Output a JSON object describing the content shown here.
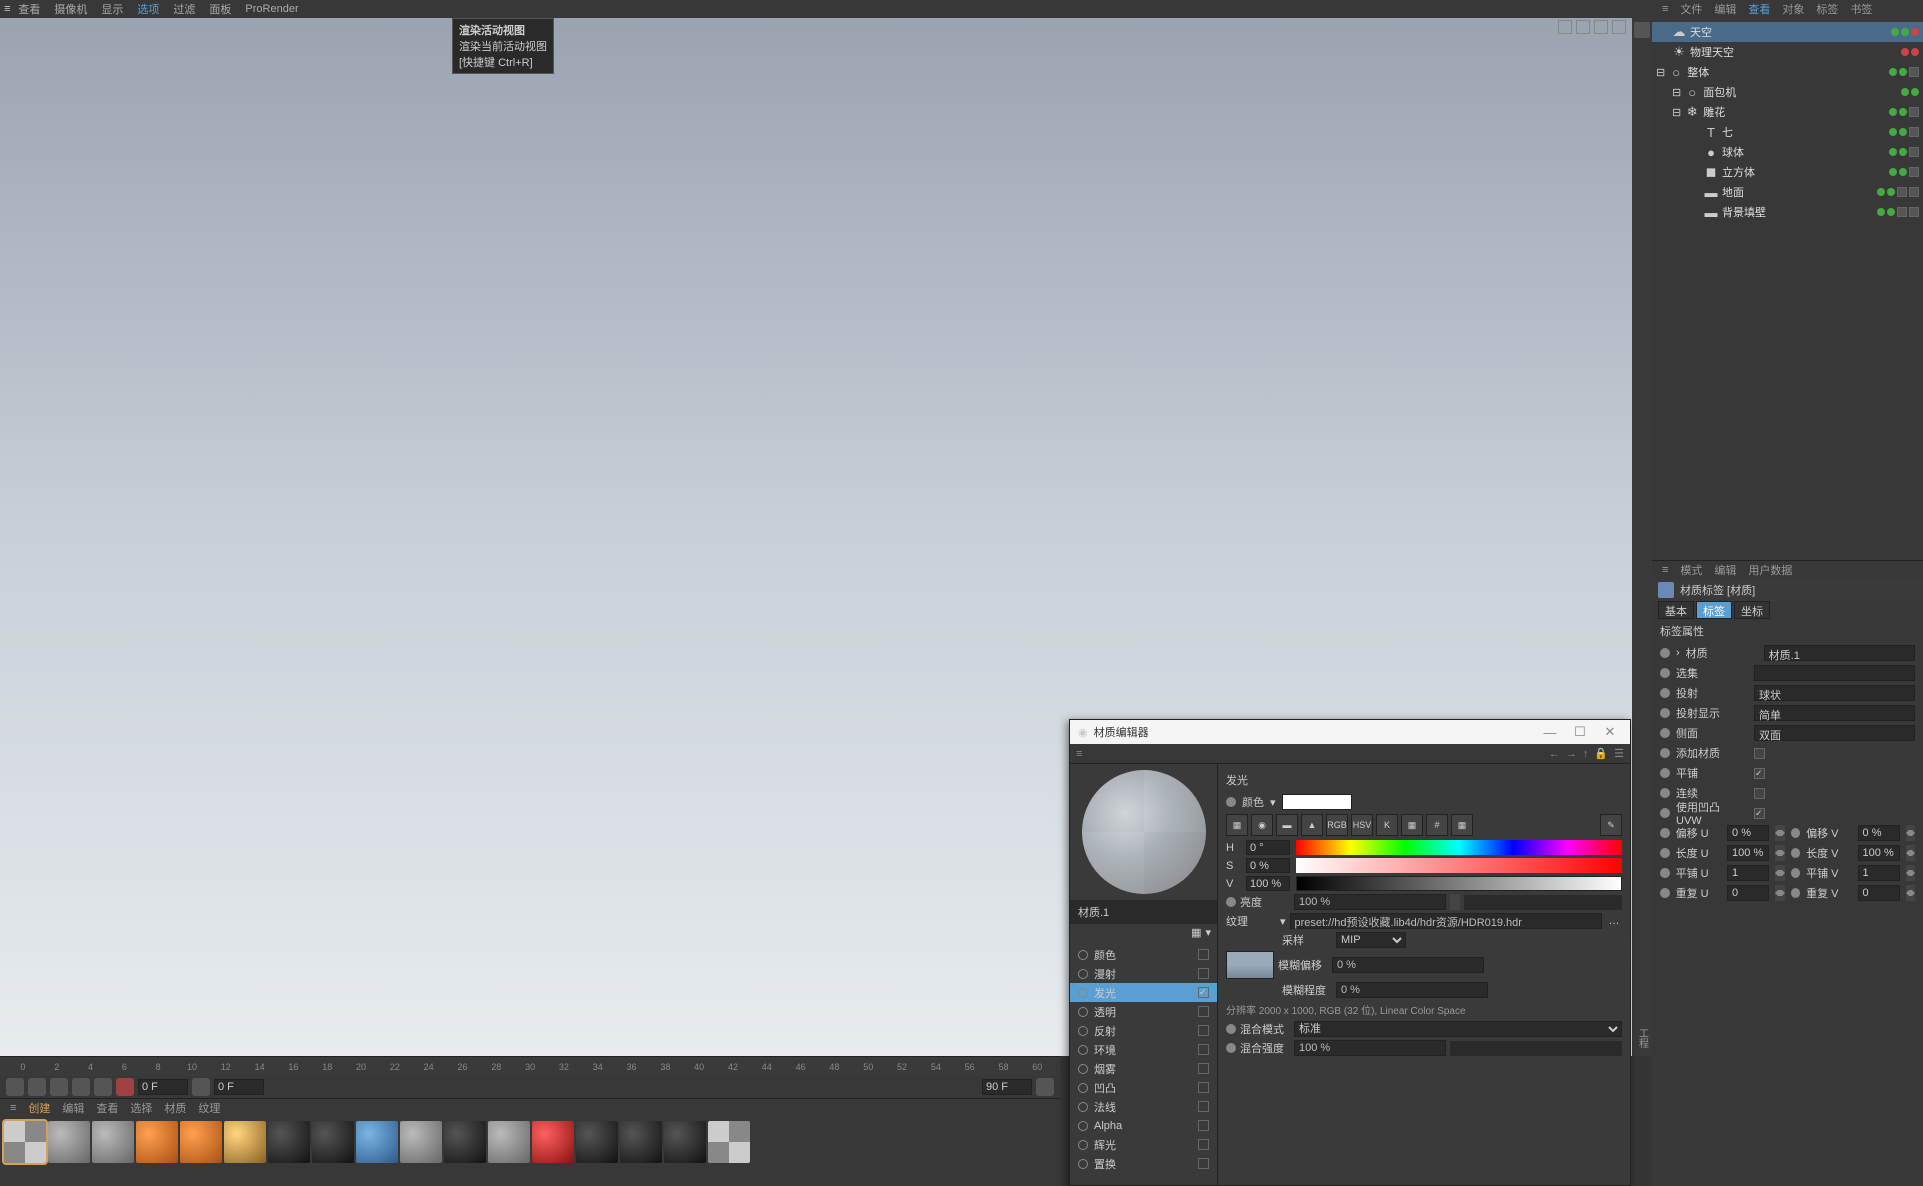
{
  "top_menu": [
    "查看",
    "摄像机",
    "显示",
    "选项",
    "过滤",
    "面板",
    "ProRender"
  ],
  "top_menu_active_index": 3,
  "tooltip": {
    "title": "渲染活动视图",
    "line1": "渲染当前活动视图",
    "line2": "[快捷键 Ctrl+R]"
  },
  "right_toolbar_label": "工程",
  "obj_tabs": [
    "文件",
    "编辑",
    "查看",
    "对象",
    "标签",
    "书签"
  ],
  "obj_tabs_active": 2,
  "objects": [
    {
      "name": "天空",
      "icon": "☁",
      "sel": true,
      "indent": 0,
      "tags": [
        "g",
        "g",
        "r"
      ]
    },
    {
      "name": "物理天空",
      "icon": "☀",
      "indent": 0,
      "tags": [
        "r",
        "r"
      ]
    },
    {
      "name": "整体",
      "icon": "○",
      "indent": 0,
      "exp": true,
      "tags": [
        "g",
        "g",
        "sq"
      ]
    },
    {
      "name": "面包机",
      "icon": "○",
      "indent": 1,
      "exp": true,
      "tags": [
        "g",
        "g"
      ]
    },
    {
      "name": "雕花",
      "icon": "❄",
      "indent": 1,
      "exp": true,
      "tags": [
        "g",
        "g",
        "sq"
      ]
    },
    {
      "name": "七",
      "icon": "T",
      "indent": 2,
      "tags": [
        "g",
        "g",
        "sq"
      ]
    },
    {
      "name": "球体",
      "icon": "●",
      "indent": 2,
      "tags": [
        "g",
        "g",
        "sq"
      ]
    },
    {
      "name": "立方体",
      "icon": "◼",
      "indent": 2,
      "tags": [
        "g",
        "g",
        "sq"
      ]
    },
    {
      "name": "地面",
      "icon": "▬",
      "indent": 2,
      "tags": [
        "g",
        "g",
        "sq",
        "sq"
      ]
    },
    {
      "name": "背景填壁",
      "icon": "▬",
      "indent": 2,
      "tags": [
        "g",
        "g",
        "sq",
        "sq"
      ]
    }
  ],
  "attr_tabs": [
    "模式",
    "编辑",
    "用户数据"
  ],
  "attr_header": "材质标签 [材质]",
  "attr_subtabs": [
    "基本",
    "标签",
    "坐标"
  ],
  "attr_subtab_active": 1,
  "attr_section": "标签属性",
  "attr_props": [
    {
      "rad": true,
      "name": "材质",
      "value": "材质.1",
      "arrow": true
    },
    {
      "rad": true,
      "name": "选集",
      "value": ""
    },
    {
      "rad": true,
      "name": "投射",
      "value": "球状"
    },
    {
      "rad": true,
      "name": "投射显示",
      "value": "简单"
    },
    {
      "rad": true,
      "name": "侧面",
      "value": "双面"
    },
    {
      "rad": true,
      "name": "添加材质",
      "chk": false
    },
    {
      "rad": true,
      "name": "平铺",
      "chk": true
    },
    {
      "rad": true,
      "name": "连续",
      "chk": false
    },
    {
      "rad": true,
      "name": "使用凹凸 UVW",
      "chk": true
    }
  ],
  "attr_grid": [
    {
      "l": "偏移 U",
      "lv": "0 %",
      "r": "偏移 V",
      "rv": "0 %"
    },
    {
      "l": "长度 U",
      "lv": "100 %",
      "r": "长度 V",
      "rv": "100 %"
    },
    {
      "l": "平铺 U",
      "lv": "1",
      "r": "平铺 V",
      "rv": "1"
    },
    {
      "l": "重复 U",
      "lv": "0",
      "r": "重复 V",
      "rv": "0"
    }
  ],
  "timeline": {
    "start": 0,
    "end": 60,
    "step": 2
  },
  "playbar": {
    "frame": "0 F",
    "pos": "0 F",
    "end": "90 F"
  },
  "mat_tabs": [
    "创建",
    "编辑",
    "查看",
    "选择",
    "材质",
    "纹理"
  ],
  "mat_tabs_active": 0,
  "mat_spheres": [
    "check",
    "mid",
    "mid",
    "orange",
    "orange",
    "gold",
    "dark",
    "dark",
    "blue",
    "mid",
    "dark",
    "mid",
    "red",
    "dark",
    "dark",
    "dark",
    "check"
  ],
  "me": {
    "title": "材质编辑器",
    "mat_name": "材质.1",
    "section": "发光",
    "color_label": "颜色",
    "channels": [
      {
        "name": "颜色",
        "chk": false
      },
      {
        "name": "漫射",
        "chk": false
      },
      {
        "name": "发光",
        "chk": true,
        "act": true
      },
      {
        "name": "透明",
        "chk": false
      },
      {
        "name": "反射",
        "chk": false
      },
      {
        "name": "环境",
        "chk": false
      },
      {
        "name": "烟雾",
        "chk": false
      },
      {
        "name": "凹凸",
        "chk": false
      },
      {
        "name": "法线",
        "chk": false
      },
      {
        "name": "Alpha",
        "chk": false
      },
      {
        "name": "辉光",
        "chk": false
      },
      {
        "name": "置换",
        "chk": false
      }
    ],
    "hsv": {
      "h": "0 °",
      "s": "0 %",
      "v": "100 %"
    },
    "brightness": {
      "label": "亮度",
      "value": "100 %"
    },
    "texture": {
      "label": "纹理",
      "value": "preset://hd预设收藏.lib4d/hdr资源/HDR019.hdr"
    },
    "sampling": {
      "label": "采样",
      "value": "MIP"
    },
    "blur_offset": {
      "label": "模糊偏移",
      "value": "0 %"
    },
    "blur_scale": {
      "label": "模糊程度",
      "value": "0 %"
    },
    "info": "分辨率 2000 x 1000, RGB (32 位), Linear Color Space",
    "mix_mode": {
      "label": "混合模式",
      "value": "标准"
    },
    "mix_strength": {
      "label": "混合强度",
      "value": "100 %"
    }
  }
}
